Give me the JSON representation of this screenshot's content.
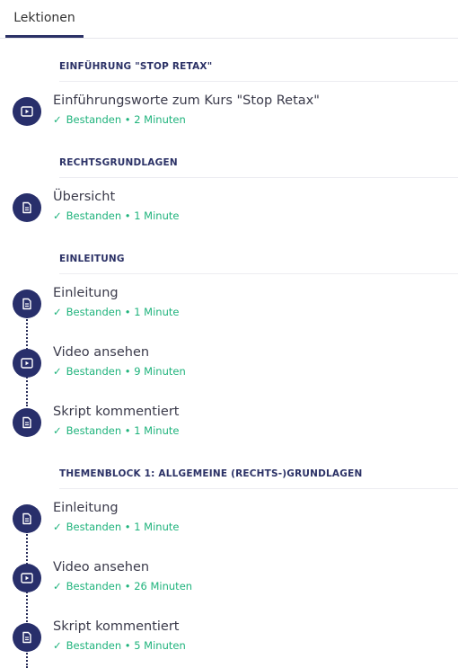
{
  "tabs": {
    "lessons": "Lektionen"
  },
  "sections": [
    {
      "title": "EINFÜHRUNG \"STOP RETAX\"",
      "lessons": [
        {
          "icon": "video-icon",
          "title": "Einführungsworte zum Kurs \"Stop Retax\"",
          "status": "Bestanden • 2 Minuten"
        }
      ]
    },
    {
      "title": "RECHTSGRUNDLAGEN",
      "lessons": [
        {
          "icon": "document-icon",
          "title": "Übersicht",
          "status": "Bestanden • 1 Minute"
        }
      ]
    },
    {
      "title": "EINLEITUNG",
      "lessons": [
        {
          "icon": "document-icon",
          "title": "Einleitung",
          "status": "Bestanden • 1 Minute"
        },
        {
          "icon": "video-icon",
          "title": "Video ansehen",
          "status": "Bestanden • 9 Minuten"
        },
        {
          "icon": "document-icon",
          "title": "Skript kommentiert",
          "status": "Bestanden • 1 Minute"
        }
      ]
    },
    {
      "title": "THEMENBLOCK 1: ALLGEMEINE (RECHTS-)GRUNDLAGEN",
      "lessons": [
        {
          "icon": "document-icon",
          "title": "Einleitung",
          "status": "Bestanden • 1 Minute"
        },
        {
          "icon": "video-icon",
          "title": "Video ansehen",
          "status": "Bestanden • 26 Minuten"
        },
        {
          "icon": "document-icon",
          "title": "Skript kommentiert",
          "status": "Bestanden • 5 Minuten"
        }
      ]
    }
  ],
  "colors": {
    "accent": "#282f6b",
    "success": "#1fb37c",
    "heading": "#2b3166"
  }
}
